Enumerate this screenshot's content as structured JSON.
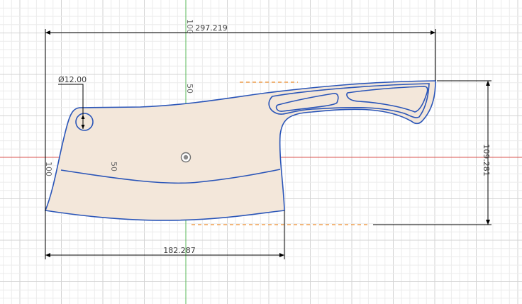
{
  "colors": {
    "background": "#ffffff",
    "grid_minor": "#ececec",
    "grid_major": "#d3d3d3",
    "axis_x": "#d9534f",
    "axis_y": "#58b858",
    "profile": "#2a55b8",
    "fill": "#f3e7da",
    "dimension": "#000000",
    "projection": "#f0a050"
  },
  "dimensions": {
    "overall_width": "297.219",
    "overall_height": "109.281",
    "blade_width": "182.287",
    "hole_diameter": "Ø12.00"
  },
  "grid_labels": {
    "top": "100",
    "upper": "50",
    "left": "100",
    "inner": "50"
  },
  "icons": {
    "origin": "origin-point-icon"
  }
}
